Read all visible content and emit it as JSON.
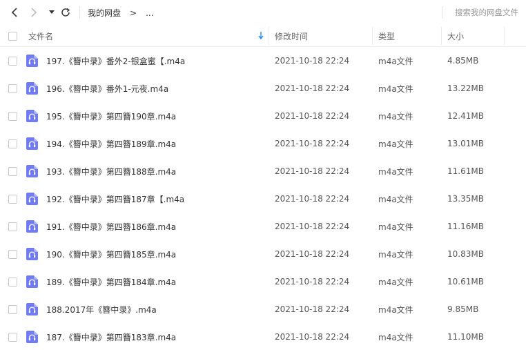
{
  "toolbar": {
    "back_icon": "chevron-left-icon",
    "forward_icon": "chevron-right-icon",
    "history_icon": "caret-down-icon",
    "refresh_icon": "refresh-icon",
    "breadcrumb": {
      "root": "我的网盘",
      "separator": ">",
      "ellipsis": "..."
    },
    "search_placeholder": "搜索我的网盘文件"
  },
  "header": {
    "name": "文件名",
    "modified": "修改时间",
    "type": "类型",
    "size": "大小",
    "sort_icon": "sort-down-arrow-icon",
    "sort_color": "#1e88f5"
  },
  "file_icon": {
    "name": "audio-file-icon",
    "color": "#6f7bf7"
  },
  "files": [
    {
      "name": "197.《簪中录》番外2-银盒蜜【.m4a",
      "modified": "2021-10-18 22:24",
      "type": "m4a文件",
      "size": "4.85MB"
    },
    {
      "name": "196.《簪中录》番外1-元夜.m4a",
      "modified": "2021-10-18 22:24",
      "type": "m4a文件",
      "size": "13.22MB"
    },
    {
      "name": "195.《簪中录》第四簪190章.m4a",
      "modified": "2021-10-18 22:24",
      "type": "m4a文件",
      "size": "12.41MB"
    },
    {
      "name": "194.《簪中录》第四簪189章.m4a",
      "modified": "2021-10-18 22:24",
      "type": "m4a文件",
      "size": "13.01MB"
    },
    {
      "name": "193.《簪中录》第四簪188章.m4a",
      "modified": "2021-10-18 22:24",
      "type": "m4a文件",
      "size": "11.61MB"
    },
    {
      "name": "192.《簪中录》第四簪187章【.m4a",
      "modified": "2021-10-18 22:24",
      "type": "m4a文件",
      "size": "13.35MB"
    },
    {
      "name": "191.《簪中录》第四簪186章.m4a",
      "modified": "2021-10-18 22:24",
      "type": "m4a文件",
      "size": "11.16MB"
    },
    {
      "name": "190.《簪中录》第四簪185章.m4a",
      "modified": "2021-10-18 22:24",
      "type": "m4a文件",
      "size": "10.83MB"
    },
    {
      "name": "189.《簪中录》第四簪184章.m4a",
      "modified": "2021-10-18 22:24",
      "type": "m4a文件",
      "size": "10.61MB"
    },
    {
      "name": "188.2017年《簪中录》.m4a",
      "modified": "2021-10-18 22:24",
      "type": "m4a文件",
      "size": "9.85MB"
    },
    {
      "name": "187.《簪中录》第四簪183章.m4a",
      "modified": "2021-10-18 22:24",
      "type": "m4a文件",
      "size": "11.10MB"
    }
  ]
}
